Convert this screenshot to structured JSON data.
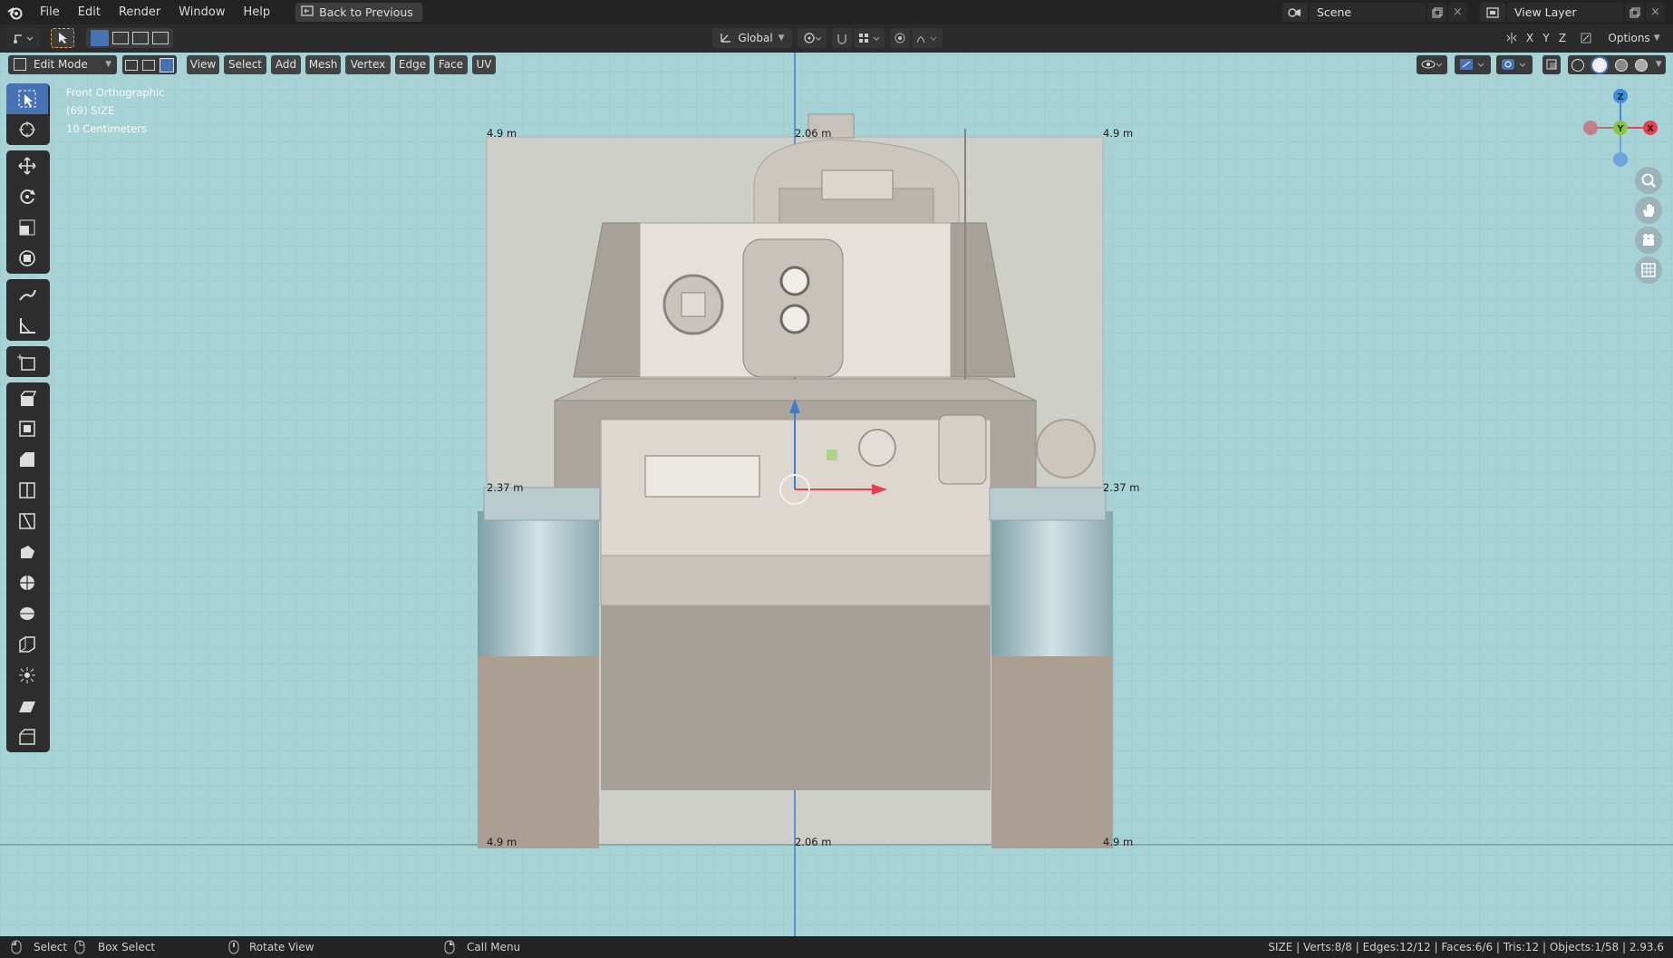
{
  "menubar": {
    "items": [
      "File",
      "Edit",
      "Render",
      "Window",
      "Help"
    ],
    "back_button": "Back to Previous",
    "scene_label": "Scene",
    "view_layer_label": "View Layer"
  },
  "toolheader": {
    "orientation": "Global",
    "options_label": "Options",
    "axes": [
      "X",
      "Y",
      "Z"
    ]
  },
  "viewport_header": {
    "mode": "Edit Mode",
    "menus": [
      "View",
      "Select",
      "Add",
      "Mesh",
      "Vertex",
      "Edge",
      "Face",
      "UV"
    ]
  },
  "viewport_overlay": {
    "view_name": "Front Orthographic",
    "object_info": "(69) SIZE",
    "grid_scale": "10 Centimeters"
  },
  "dimensions": {
    "top_left": "4.9 m",
    "top_center": "2.06 m",
    "top_right": "4.9 m",
    "mid_left": "2.37 m",
    "mid_right": "2.37 m",
    "bottom_left": "4.9 m",
    "bottom_center": "2.06 m",
    "bottom_right": "4.9 m"
  },
  "gizmo": {
    "axes": [
      "Z",
      "Y",
      "X"
    ],
    "colors": {
      "x": "#e8404f",
      "y": "#8bc63f",
      "z": "#3f8ddd"
    }
  },
  "statusbar": {
    "select": "Select",
    "box_select": "Box Select",
    "rotate_view": "Rotate View",
    "call_menu": "Call Menu",
    "stats": "SIZE | Verts:8/8 | Edges:12/12 | Faces:6/6 | Tris:12 | Objects:1/58 | 2.93.6"
  },
  "tools": [
    "select-box",
    "cursor",
    "move",
    "rotate",
    "scale",
    "transform",
    "annotate",
    "measure",
    "add-cube",
    "extrude",
    "inset",
    "bevel",
    "loop-cut",
    "knife",
    "poly-build",
    "spin",
    "smooth",
    "edge-slide",
    "shrink-fatten",
    "shear",
    "rip"
  ],
  "colors": {
    "accent": "#4772b3",
    "viewport_bg": "#a7d3d6",
    "header_bg": "#2b2b2b"
  }
}
